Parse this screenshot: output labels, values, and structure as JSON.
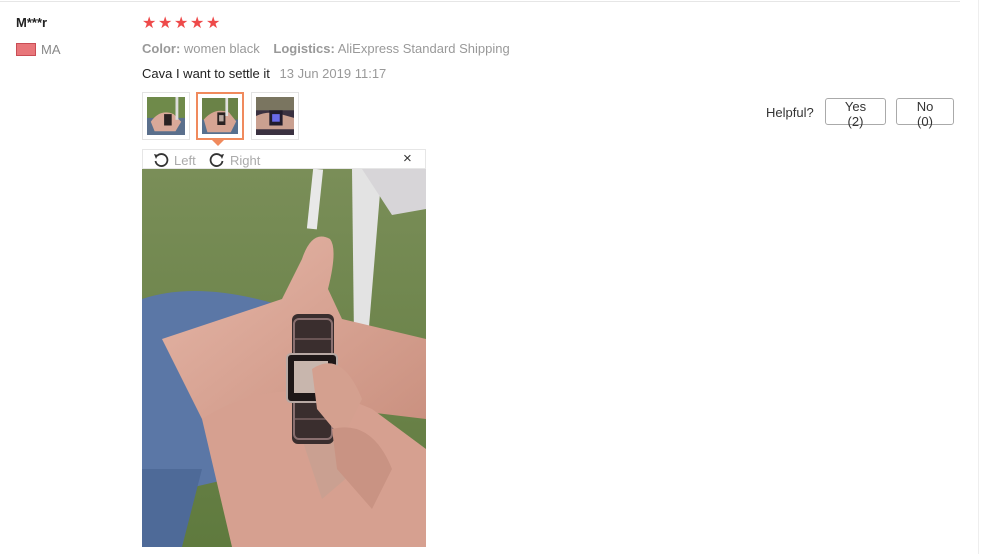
{
  "reviewer": {
    "name": "M***r",
    "country": "MA"
  },
  "rating": {
    "stars_filled": 5,
    "stars_total": 5,
    "star_glyph": "★",
    "color": "#ee4a4a"
  },
  "order": {
    "color_label": "Color:",
    "color_value": "women black",
    "logistics_label": "Logistics:",
    "logistics_value": "AliExpress Standard Shipping"
  },
  "review": {
    "text": "Cava I want to settle it",
    "date": "13 Jun 2019 11:17"
  },
  "thumbnails": [
    {
      "icon": "watch-photo-thumbnail",
      "selected": false
    },
    {
      "icon": "watch-photo-thumbnail",
      "selected": true
    },
    {
      "icon": "watch-photo-thumbnail",
      "selected": false
    }
  ],
  "viewer": {
    "rotate_left_label": "Left",
    "rotate_right_label": "Right",
    "close_glyph": "×",
    "image_icon": "wrist-watch-photo"
  },
  "helpful": {
    "label": "Helpful?",
    "yes_label": "Yes (2)",
    "no_label": "No (0)"
  },
  "colors": {
    "accent": "#f08a5d",
    "star": "#ee4a4a",
    "muted_text": "#999999"
  }
}
